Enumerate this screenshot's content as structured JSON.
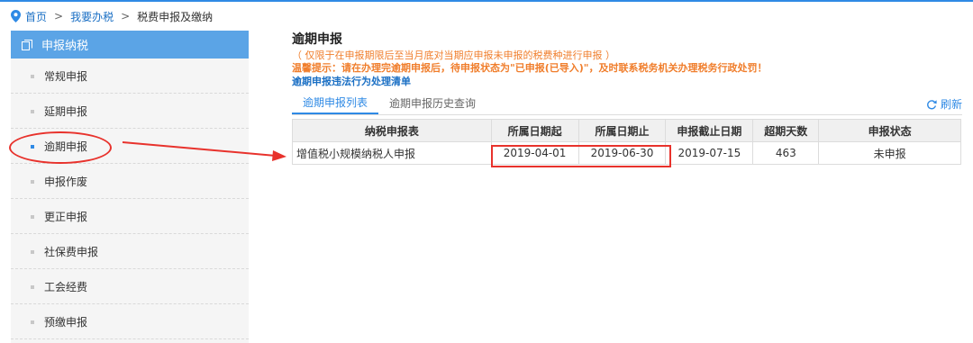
{
  "colors": {
    "accent": "#2f8ae5",
    "sidebar_header": "#5ba4e6",
    "warning": "#f07e2c",
    "annotation_red": "#e8322c"
  },
  "breadcrumb": {
    "home": "首页",
    "sep1": ">",
    "level2": "我要办税",
    "sep2": ">",
    "current": "税费申报及缴纳"
  },
  "sidebar": {
    "header": "申报纳税",
    "items": [
      {
        "label": "常规申报"
      },
      {
        "label": "延期申报"
      },
      {
        "label": "逾期申报"
      },
      {
        "label": "申报作废"
      },
      {
        "label": "更正申报"
      },
      {
        "label": "社保费申报"
      },
      {
        "label": "工会经费"
      },
      {
        "label": "预缴申报"
      }
    ]
  },
  "main": {
    "title": "逾期申报",
    "note_scope": "（ 仅限于在申报期限后至当月底对当期应申报未申报的税费种进行申报 ）",
    "note_warning": "温馨提示：请在办理完逾期申报后，待申报状态为\"已申报(已导入)\"，及时联系税务机关办理税务行政处罚！",
    "note_link": "逾期申报违法行为处理清单",
    "tabs": [
      {
        "label": "逾期申报列表"
      },
      {
        "label": "逾期申报历史查询"
      }
    ],
    "refresh_label": "刷新",
    "table": {
      "headers": [
        "纳税申报表",
        "所属日期起",
        "所属日期止",
        "申报截止日期",
        "超期天数",
        "申报状态"
      ],
      "rows": [
        [
          "增值税小规模纳税人申报",
          "2019-04-01",
          "2019-06-30",
          "2019-07-15",
          "463",
          "未申报"
        ]
      ]
    }
  }
}
